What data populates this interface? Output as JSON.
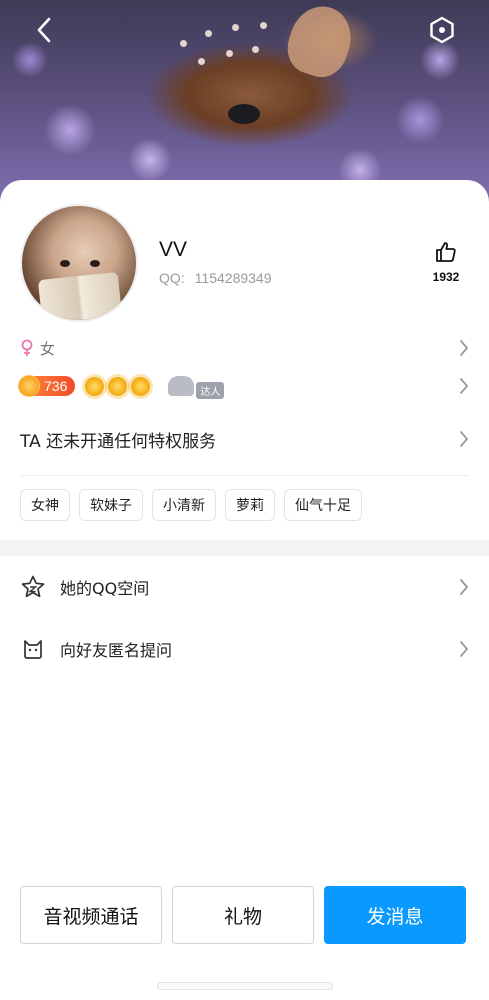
{
  "header": {
    "back_icon": "chevron-left-icon",
    "share_icon": "hexagon-icon",
    "cover_image": "deer-lying-in-purple-flowers"
  },
  "profile": {
    "name": "VV",
    "qq_label": "QQ:",
    "qq_number": "1154289349",
    "avatar": "girl-holding-book-avatar",
    "likes_icon": "thumbs-up-icon",
    "likes_count": "1932"
  },
  "info": {
    "gender_icon": "female-symbol-icon",
    "gender_label": "女",
    "level_number": "736",
    "talent_badge_label": "达人",
    "privilege_text": "TA 还未开通任何特权服务"
  },
  "tags": [
    "女神",
    "软妹子",
    "小清新",
    "萝莉",
    "仙气十足"
  ],
  "menu": {
    "qzone_label": "她的QQ空间",
    "ask_label": "向好友匿名提问"
  },
  "actions": {
    "call_label": "音视频通话",
    "gift_label": "礼物",
    "message_label": "发消息"
  },
  "colors": {
    "primary": "#0a99ff",
    "level_badge": "#f04a2a",
    "gender_female": "#ee7ab0"
  }
}
